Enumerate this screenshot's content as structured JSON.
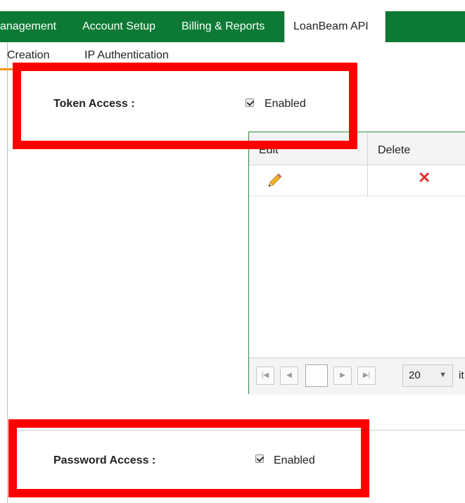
{
  "top_nav": {
    "items": [
      {
        "label": "anagement"
      },
      {
        "label": "Account Setup"
      },
      {
        "label": "Billing & Reports"
      },
      {
        "label": "LoanBeam API"
      }
    ],
    "active_index": 3
  },
  "sub_tabs": {
    "items": [
      {
        "label": "Creation"
      },
      {
        "label": "IP Authentication"
      }
    ]
  },
  "token_access": {
    "label": "Token Access :",
    "checkbox_label": "Enabled",
    "checked": true
  },
  "grid": {
    "columns": [
      {
        "label": "Edit"
      },
      {
        "label": "Delete"
      }
    ],
    "rows": [
      {
        "edit_icon": "pencil-icon",
        "delete_icon": "red-x-icon"
      }
    ],
    "pager": {
      "current_page": "",
      "page_size": "20",
      "items_text": "it"
    }
  },
  "password_access": {
    "label": "Password Access :",
    "checkbox_label": "Enabled",
    "checked": true
  },
  "colors": {
    "nav_green": "#0c7a34",
    "grid_border": "#2e8b3c",
    "highlight_red": "#ff0000",
    "tab_underline": "#f7941d",
    "delete_red": "#e8312a"
  }
}
